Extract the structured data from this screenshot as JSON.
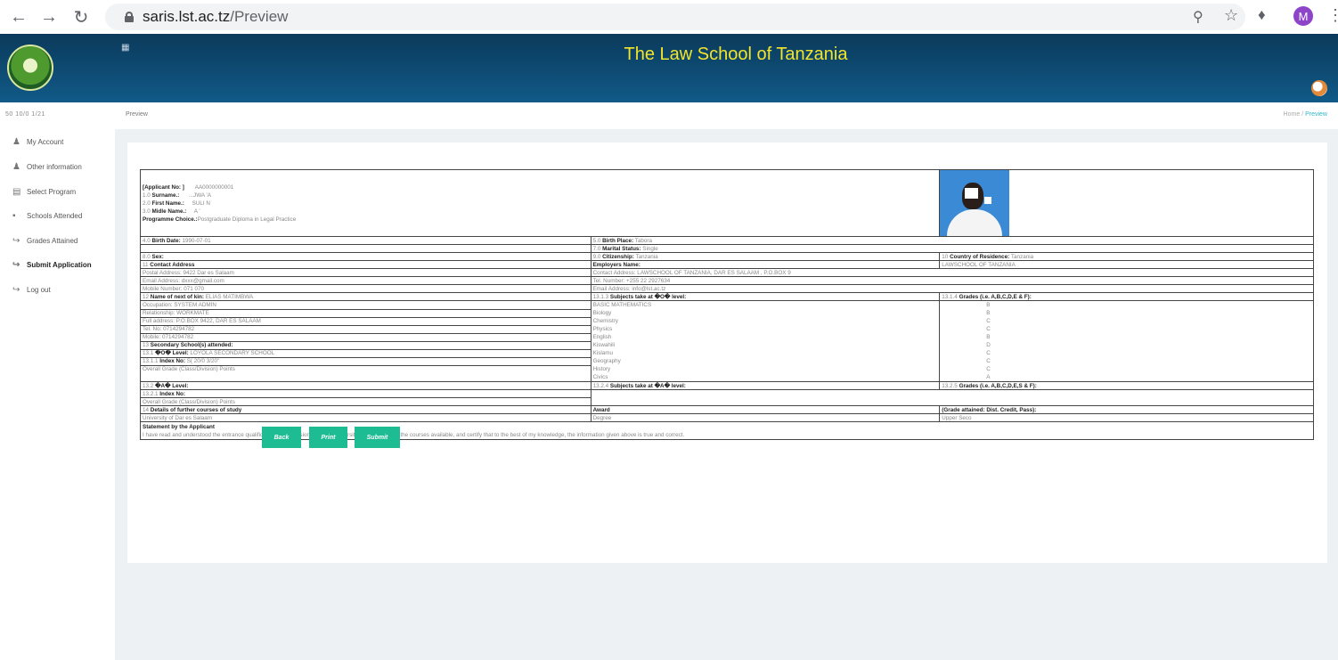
{
  "browser": {
    "url_host": "saris.lst.ac.tz",
    "url_path": "/Preview",
    "profile_initial": "M"
  },
  "header": {
    "title": "The Law School of Tanzania"
  },
  "sidebar": {
    "meta": "50   10/0   1/21",
    "items": [
      {
        "label": "My Account",
        "icon": "user-icon"
      },
      {
        "label": "Other information",
        "icon": "user-icon"
      },
      {
        "label": "Select Program",
        "icon": "list-icon"
      },
      {
        "label": "Schools Attended",
        "icon": "square-icon"
      },
      {
        "label": "Grades Attained",
        "icon": "login-icon"
      },
      {
        "label": "Submit Application",
        "icon": "login-icon"
      },
      {
        "label": "Log out",
        "icon": "login-icon"
      }
    ]
  },
  "page": {
    "title": "Preview",
    "breadcrumb_home": "Home",
    "breadcrumb_sep": "/",
    "breadcrumb_current": "Preview"
  },
  "form": {
    "applicant_no_label": "[Applicant No: ]",
    "applicant_no": "AA0000000001",
    "surname_num": "1.0",
    "surname_label": "Surname.:",
    "surname": "...JWA  'A",
    "first_num": "2.0",
    "first_label": "First Name.:",
    "first": "SULI  N",
    "middle_num": "3.0",
    "middle_label": "Midle Name.:",
    "middle": "A   '",
    "programme_label": "Programme Choice.:",
    "programme": "Postgraduate Diploma in Legal Practice",
    "birth_date_num": "4.0",
    "birth_date_label": "Birth Date:",
    "birth_date": "1990-07-01",
    "birth_place_num": "5.0",
    "birth_place_label": "Birth Place:",
    "birth_place": "Tabora",
    "marital_num": "7.0",
    "marital_label": "Marital Status:",
    "marital": "Single",
    "sex_num": "8.0",
    "sex_label": "Sex:",
    "citizenship_num": "9.0",
    "citizenship_label": "Citizenship:",
    "citizenship": "Tanzania",
    "residence_num": "10",
    "residence_label": "Country of Residence:",
    "residence": "Tanzania",
    "contact_num": "11",
    "contact_label": "Contact Address",
    "employers_label": "Employers Name:",
    "employers": "LAWSCHOOL OF TANZANIA",
    "postal": "Postal Address: 9422 Dar es Salaam",
    "emp_contact": "Contact Address: LAWSCHOOL OF TANZANIA, DAR ES SALAAM , P.O.BOX 9",
    "email": "Email Address: dxxx@gmail.com",
    "tel": "Tel. Number: +255 22 2927634",
    "mobile": "Mobile Number: 071    070",
    "emp_email": "Email Address: info@lst.ac.tz",
    "nok_num": "12",
    "nok_label": "Name of next of kin:",
    "nok": "ELIAS MATIMBWA",
    "o_subjects_num": "13.1.3",
    "o_subjects_label": "Subjects take at �O� level:",
    "o_grades_num": "13.1.4",
    "o_grades_label": "Grades (i.e. A,B,C,D,E & F):",
    "nok_details": [
      "Occupation: SYSTEM ADMIN",
      "Relationship: WORKMATE",
      "Full address: P.O.BOX 9422, DAR ES SALAAM",
      "Tel. No: 0714294782",
      "Mobile: 0714294782"
    ],
    "secondary_num": "13",
    "secondary_label": "Secondary School(s) attended:",
    "o_level_num": "13.1",
    "o_level_label": "�O� Level:",
    "o_level": "LOYOLA SECONDARY SCHOOL",
    "index_num": "13.1.1",
    "index_label": "Index No:",
    "index": "S(    20/0    3/20''",
    "overall": "Overall Grade (Class/Division) Points",
    "subjects": [
      {
        "name": "BASIC MATHEMATICS",
        "grade": "B"
      },
      {
        "name": "Biology",
        "grade": "B"
      },
      {
        "name": "Chemistry",
        "grade": "C"
      },
      {
        "name": "Physics",
        "grade": "C"
      },
      {
        "name": "English",
        "grade": "B"
      },
      {
        "name": "Kiswahili",
        "grade": "D"
      },
      {
        "name": "Kislamu",
        "grade": "C"
      },
      {
        "name": "Geography",
        "grade": "C"
      },
      {
        "name": "History",
        "grade": "C"
      },
      {
        "name": "Civics",
        "grade": "A"
      }
    ],
    "a_level_num": "13.2",
    "a_level_label": "�A� Level:",
    "a_subjects_num": "13.2.4",
    "a_subjects_label": "Subjects take at �A� level:",
    "a_grades_num": "13.2.5",
    "a_grades_label": "Grades (i.e. A,B,C,D,E,S & F):",
    "a_index_num": "13.2.1",
    "a_index_label": "Index No:",
    "a_overall": "Overall Grade (Class/Division) Points",
    "further_num": "14",
    "further_label": "Details of further courses of study",
    "award_label": "Award",
    "attained_label": "(Grade attained: Dist. Credit, Pass):",
    "university": "University of Dar es Salaam",
    "award": "Degree",
    "attained": "Upper Seco",
    "statement_label": "Statement by the Applicant",
    "statement": "I have read and understood the entrance qualification for admission to Open University of Tanzania and the courses available, and certify that to the best of my knowledge, the information given above is true and correct."
  },
  "actions": {
    "back": "Back",
    "print": "Print",
    "submit": "Submit"
  }
}
